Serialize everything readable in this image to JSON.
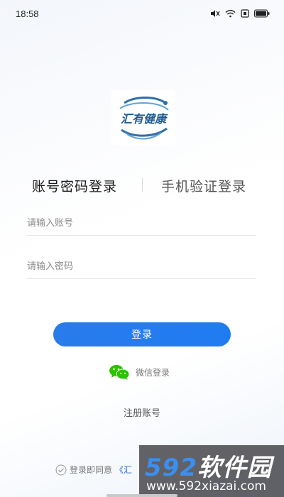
{
  "status_bar": {
    "time": "18:58",
    "icons": [
      "mute-icon",
      "wifi-icon",
      "sim-icon",
      "battery-icon"
    ]
  },
  "logo": {
    "text": "汇有健康",
    "icon": "dragon-logo-icon"
  },
  "tabs": [
    {
      "label": "账号密码登录",
      "active": true
    },
    {
      "label": "手机验证登录",
      "active": false
    }
  ],
  "form": {
    "account_placeholder": "请输入账号",
    "account_value": "",
    "password_placeholder": "请输入密码",
    "password_value": ""
  },
  "login_button": {
    "label": "登录"
  },
  "wechat_login": {
    "label": "微信登录",
    "icon": "wechat-icon"
  },
  "register_link": "注册账号",
  "agreement": {
    "text": "登录即同意",
    "link": "《汇",
    "checked": false
  },
  "watermark": {
    "brand_num": "592",
    "brand_text": "软件园",
    "url": "www.592xiazai.com"
  },
  "colors": {
    "accent": "#2a7bec",
    "wechat": "#2dc100"
  }
}
